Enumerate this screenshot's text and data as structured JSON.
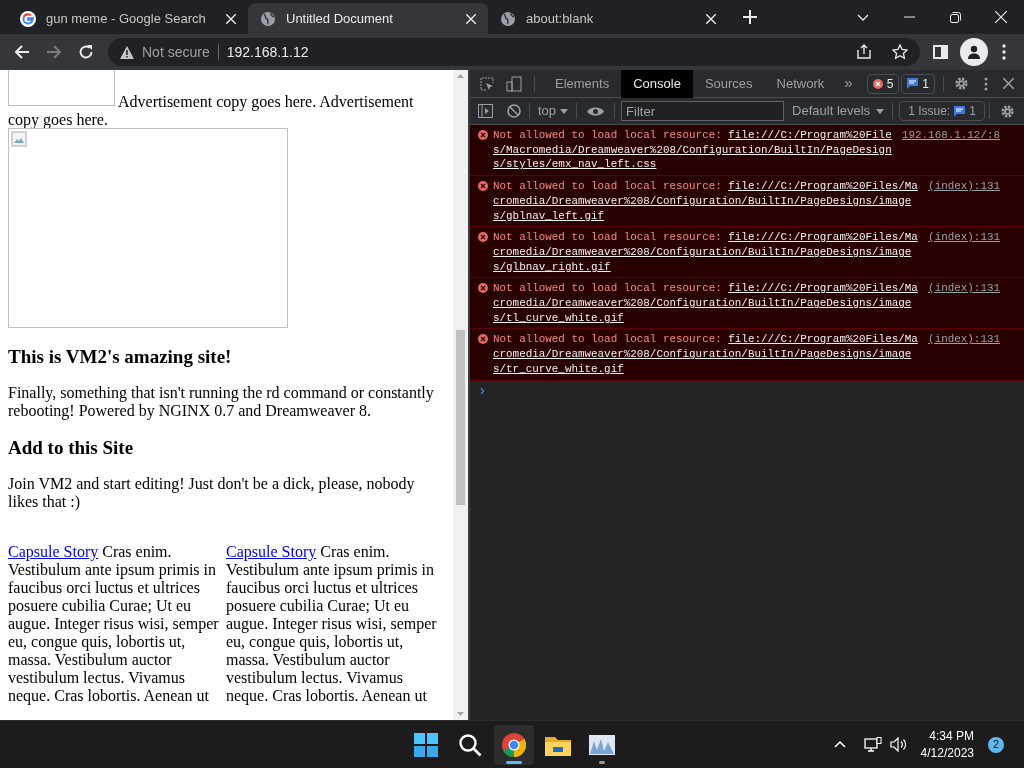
{
  "tabs": [
    {
      "title": "gun meme - Google Search",
      "selected": false
    },
    {
      "title": "Untitled Document",
      "selected": true
    },
    {
      "title": "about:blank",
      "selected": false
    }
  ],
  "address_bar": {
    "security": "Not secure",
    "url": "192.168.1.12"
  },
  "page": {
    "ad_text": "Advertisement copy goes here. Advertisement copy goes here.",
    "heading_1": "This is VM2's amazing site!",
    "paragraph_1": "Finally, something that isn't running the rd command or constantly rebooting! Powered by NGINX 0.7 and Dreamweaver 8.",
    "heading_2": "Add to this Site",
    "paragraph_2": "Join VM2 and start editing! Just don't be a dick, please, nobody likes that :)",
    "columns": [
      {
        "link": "Capsule Story",
        "text": "Cras enim. Vestibulum ante ipsum primis in faucibus orci luctus et ultrices posuere cubilia Curae; Ut eu augue. Integer risus wisi, semper eu, congue quis, lobortis ut, massa. Vestibulum auctor vestibulum lectus. Vivamus neque. Cras lobortis. Aenean ut"
      },
      {
        "link": "Capsule Story",
        "text": "Cras enim. Vestibulum ante ipsum primis in faucibus orci luctus et ultrices posuere cubilia Curae; Ut eu augue. Integer risus wisi, semper eu, congue quis, lobortis ut, massa. Vestibulum auctor vestibulum lectus. Vivamus neque. Cras lobortis. Aenean ut"
      }
    ]
  },
  "devtools": {
    "tabs": [
      {
        "label": "Elements",
        "selected": false
      },
      {
        "label": "Console",
        "selected": true
      },
      {
        "label": "Sources",
        "selected": false
      },
      {
        "label": "Network",
        "selected": false
      }
    ],
    "more": "»",
    "error_count": "5",
    "message_count": "1",
    "context": "top",
    "filter_placeholder": "Filter",
    "levels": "Default levels",
    "issues_label": "1 Issue:",
    "issues_count": "1",
    "messages": [
      {
        "text": "Not allowed to load local resource:",
        "url": "file:///C:/Program%20Files/Macromedia/Dreamweaver%208/Configuration/BuiltIn/PageDesigns/styles/emx_nav_left.css",
        "source": "192.168.1.12/:8"
      },
      {
        "text": "Not allowed to load local resource:",
        "url": "file:///C:/Program%20Files/Macromedia/Dreamweaver%208/Configuration/BuiltIn/PageDesigns/images/gblnav_left.gif",
        "source": "(index):131"
      },
      {
        "text": "Not allowed to load local resource:",
        "url": "file:///C:/Program%20Files/Macromedia/Dreamweaver%208/Configuration/BuiltIn/PageDesigns/images/glbnav_right.gif",
        "source": "(index):131"
      },
      {
        "text": "Not allowed to load local resource:",
        "url": "file:///C:/Program%20Files/Macromedia/Dreamweaver%208/Configuration/BuiltIn/PageDesigns/images/tl_curve_white.gif",
        "source": "(index):131"
      },
      {
        "text": "Not allowed to load local resource:",
        "url": "file:///C:/Program%20Files/Macromedia/Dreamweaver%208/Configuration/BuiltIn/PageDesigns/images/tr_curve_white.gif",
        "source": "(index):131"
      }
    ],
    "prompt": "›"
  },
  "taskbar": {
    "apps": [
      {
        "kind": "start",
        "active": false
      },
      {
        "kind": "search",
        "active": false
      },
      {
        "kind": "chrome",
        "active": true
      },
      {
        "kind": "explorer",
        "active": false
      },
      {
        "kind": "monitor",
        "active": false
      }
    ],
    "time": "4:34 PM",
    "date": "4/12/2023",
    "notifications": "2"
  }
}
